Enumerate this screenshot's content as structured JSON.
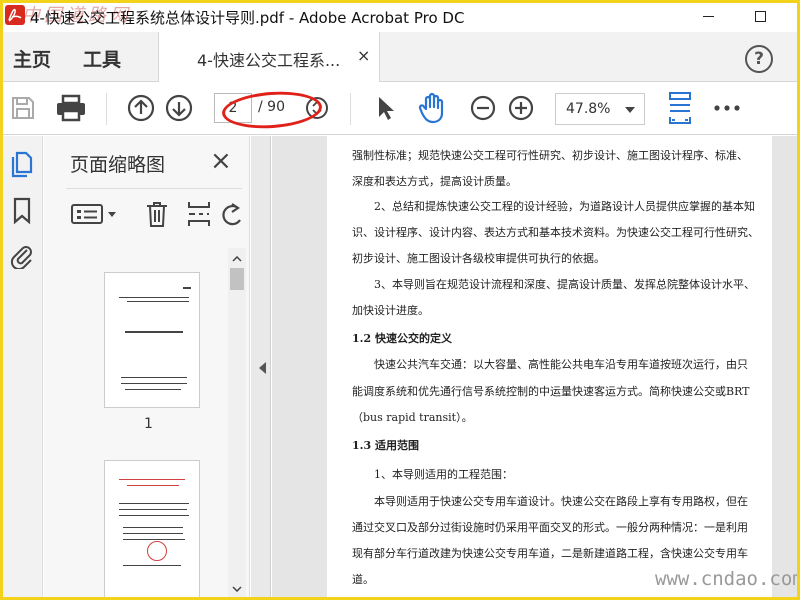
{
  "window": {
    "title": "4-快速公交工程系统总体设计导则.pdf - Adobe Acrobat Pro DC",
    "watermark_top_left": "中国道路网"
  },
  "tabs": {
    "home": "主页",
    "tools": "工具",
    "document": "4-快速公交工程系...",
    "close": "×",
    "help": "?"
  },
  "toolbar": {
    "page_current": "2",
    "page_total": "/ 90",
    "zoom": "47.8%"
  },
  "thumbnails": {
    "title": "页面缩略图",
    "close": "×",
    "page1_label": "1"
  },
  "document": {
    "lines": [
      "强制性标准；规范快速公交工程可行性研究、初步设计、施工图设计程序、标准、",
      "深度和表达方式，提高设计质量。",
      "　　2、总结和提炼快速公交工程的设计经验，为道路设计人员提供应掌握的基本知",
      "识、设计程序、设计内容、表达方式和基本技术资料。为快速公交工程可行性研究、",
      "初步设计、施工图设计各级校审提供可执行的依据。",
      "　　3、本导则旨在规范设计流程和深度、提高设计质量、发挥总院整体设计水平、",
      "加快设计进度。",
      "1.2 快速公交的定义",
      "　　快速公共汽车交通：以大容量、高性能公共电车沿专用车道按班次运行，由只",
      "能调度系统和优先通行信号系统控制的中运量快速客运方式。简称快速公交或BRT",
      "（bus rapid transit）。",
      "1.3 适用范围",
      "　　1、本导则适用的工程范围：",
      "　　本导则适用于快速公交专用车道设计。快速公交在路段上享有专用路权，但在",
      "通过交叉口及部分过街设施时仍采用平面交叉的形式。一般分两种情况：一是利用",
      "现有部分车行道改建为快速公交专用车道，二是新建道路工程，含快速公交专用车",
      "道。"
    ],
    "watermark": "www.cndao.com"
  },
  "colors": {
    "accent_blue": "#2a75d3",
    "annotation_red": "#e0211a",
    "frame_yellow": "#f3d21c"
  }
}
